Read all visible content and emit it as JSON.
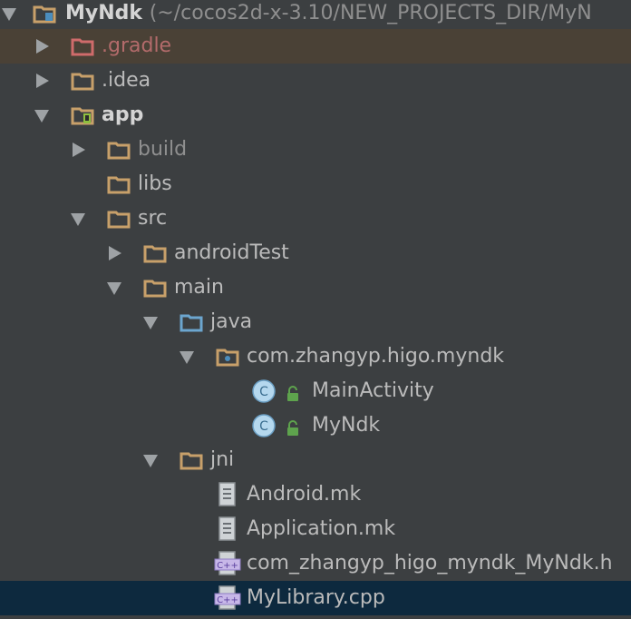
{
  "tree": {
    "root": {
      "name": "MyNdk",
      "path": "(~/cocos2d-x-3.10/NEW_PROJECTS_DIR/MyN"
    },
    "items": [
      {
        "label": ".gradle"
      },
      {
        "label": ".idea"
      },
      {
        "label": "app"
      },
      {
        "label": "build"
      },
      {
        "label": "libs"
      },
      {
        "label": "src"
      },
      {
        "label": "androidTest"
      },
      {
        "label": "main"
      },
      {
        "label": "java"
      },
      {
        "label": "com.zhangyp.higo.myndk"
      },
      {
        "label": "MainActivity"
      },
      {
        "label": "MyNdk"
      },
      {
        "label": "jni"
      },
      {
        "label": "Android.mk"
      },
      {
        "label": "Application.mk"
      },
      {
        "label": "com_zhangyp_higo_myndk_MyNdk.h"
      },
      {
        "label": "MyLibrary.cpp"
      }
    ],
    "class_badge": "C",
    "cpp_badge": "C++"
  },
  "colors": {
    "folder": "#c8a06a",
    "folder_red": "#cf6b6b",
    "folder_blue": "#6ca6cf",
    "selection": "#0d293e",
    "highlight": "#4a4136"
  }
}
